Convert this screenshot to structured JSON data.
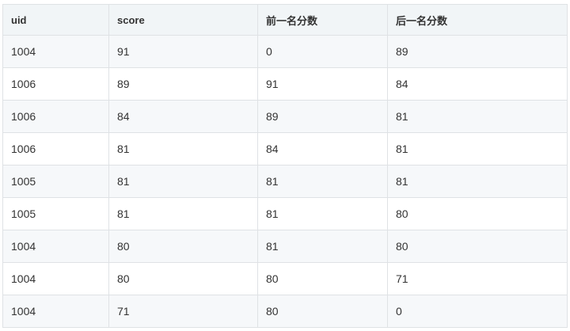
{
  "table": {
    "headers": [
      "uid",
      "score",
      "前一名分数",
      "后一名分数"
    ],
    "rows": [
      [
        "1004",
        "91",
        "0",
        "89"
      ],
      [
        "1006",
        "89",
        "91",
        "84"
      ],
      [
        "1006",
        "84",
        "89",
        "81"
      ],
      [
        "1006",
        "81",
        "84",
        "81"
      ],
      [
        "1005",
        "81",
        "81",
        "81"
      ],
      [
        "1005",
        "81",
        "81",
        "80"
      ],
      [
        "1004",
        "80",
        "81",
        "80"
      ],
      [
        "1004",
        "80",
        "80",
        "71"
      ],
      [
        "1004",
        "71",
        "80",
        "0"
      ]
    ]
  },
  "colors": {
    "header_bg": "#f1f5f7",
    "row_alt_bg": "#f6f8fa",
    "border": "#dfe2e5",
    "text": "#333333"
  }
}
